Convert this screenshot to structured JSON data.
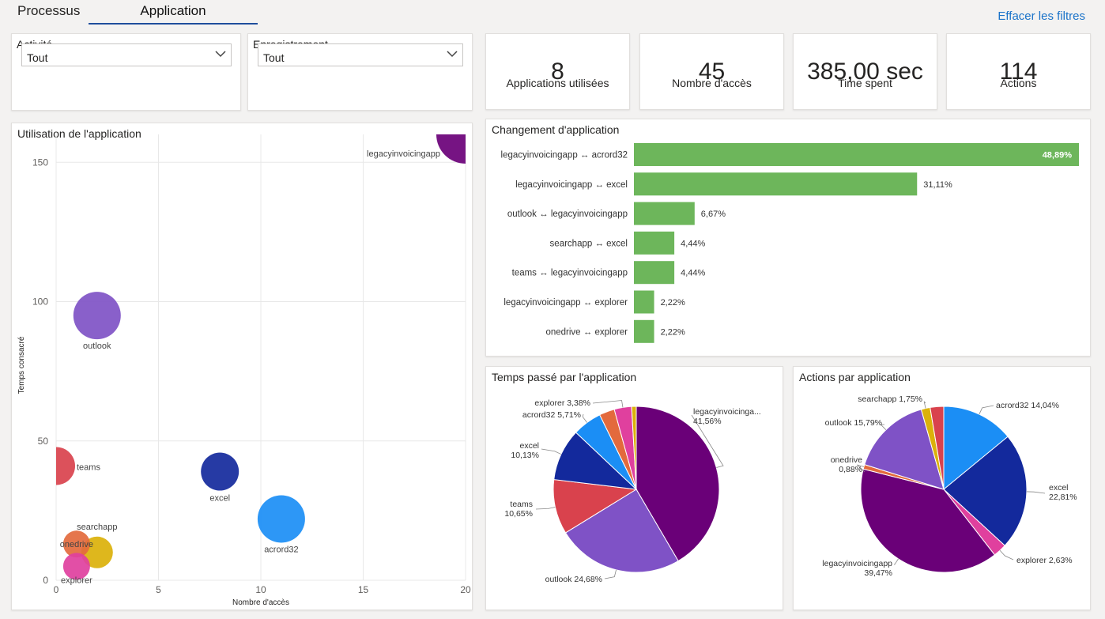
{
  "tabs": [
    {
      "label": "Processus",
      "active": false
    },
    {
      "label": "Application",
      "active": true
    }
  ],
  "clear_filters_label": "Effacer les filtres",
  "filters": [
    {
      "label": "Activité",
      "value": "Tout"
    },
    {
      "label": "Enregistrement",
      "value": "Tout"
    }
  ],
  "kpis": [
    {
      "value": "8",
      "label": "Applications utilisées"
    },
    {
      "value": "45",
      "label": "Nombre d'accès"
    },
    {
      "value": "385,00 sec",
      "label": "Time spent"
    },
    {
      "value": "114",
      "label": "Actions"
    }
  ],
  "colors": {
    "accent": "#1a73c9",
    "bar_green": "#6db65b",
    "legacyinvoicingapp": "#6a0078",
    "outlook": "#7f52c6",
    "teams": "#d9424d",
    "excel": "#13299c",
    "acrord32": "#1b8ef5",
    "searchapp": "#dbb10a",
    "onedrive": "#e36a3d",
    "explorer": "#e0409e"
  },
  "chart_data": [
    {
      "type": "scatter",
      "title": "Utilisation de l'application",
      "xlabel": "Nombre d'accès",
      "ylabel": "Temps consacré",
      "xlim": [
        0,
        20
      ],
      "ylim": [
        0,
        160
      ],
      "xticks": [
        0,
        5,
        10,
        15,
        20
      ],
      "yticks": [
        0,
        50,
        100,
        150
      ],
      "grid": true,
      "points": [
        {
          "name": "legacyinvoicingapp",
          "x": 20,
          "y": 160,
          "size": 37
        },
        {
          "name": "outlook",
          "x": 2,
          "y": 95,
          "size": 30
        },
        {
          "name": "teams",
          "x": 0,
          "y": 41,
          "size": 24
        },
        {
          "name": "excel",
          "x": 8,
          "y": 39,
          "size": 24
        },
        {
          "name": "acrord32",
          "x": 11,
          "y": 22,
          "size": 30
        },
        {
          "name": "searchapp",
          "x": 2,
          "y": 10,
          "size": 20
        },
        {
          "name": "onedrive",
          "x": 1,
          "y": 13,
          "size": 17
        },
        {
          "name": "explorer",
          "x": 1,
          "y": 5,
          "size": 17
        }
      ]
    },
    {
      "type": "bar",
      "title": "Changement d'application",
      "categories": [
        "legacyinvoicingapp ↔ acrord32",
        "legacyinvoicingapp ↔ excel",
        "outlook ↔ legacyinvoicingapp",
        "searchapp ↔ excel",
        "teams ↔ legacyinvoicingapp",
        "legacyinvoicingapp ↔ explorer",
        "onedrive ↔ explorer"
      ],
      "values": [
        48.89,
        31.11,
        6.67,
        4.44,
        4.44,
        2.22,
        2.22
      ],
      "value_labels": [
        "48,89%",
        "31,11%",
        "6,67%",
        "4,44%",
        "4,44%",
        "2,22%",
        "2,22%"
      ]
    },
    {
      "type": "pie",
      "title": "Temps passé par l'application",
      "slices": [
        {
          "name": "legacyinvoicingapp",
          "value": 41.56,
          "label_lines": [
            "legacyinvoicinga...",
            "41,56%"
          ]
        },
        {
          "name": "outlook",
          "value": 24.68,
          "label_lines": [
            "outlook 24,68%"
          ]
        },
        {
          "name": "teams",
          "value": 10.65,
          "label_lines": [
            "teams",
            "10,65%"
          ]
        },
        {
          "name": "excel",
          "value": 10.13,
          "label_lines": [
            "excel",
            "10,13%"
          ]
        },
        {
          "name": "acrord32",
          "value": 5.71,
          "label_lines": [
            "acrord32 5,71%"
          ]
        },
        {
          "name": "onedrive",
          "value": 2.99,
          "label_lines": []
        },
        {
          "name": "explorer",
          "value": 3.38,
          "label_lines": [
            "explorer 3,38%"
          ]
        },
        {
          "name": "searchapp",
          "value": 0.9,
          "label_lines": []
        }
      ]
    },
    {
      "type": "pie",
      "title": "Actions par application",
      "slices": [
        {
          "name": "acrord32",
          "value": 14.04,
          "label_lines": [
            "acrord32 14,04%"
          ]
        },
        {
          "name": "excel",
          "value": 22.81,
          "label_lines": [
            "excel",
            "22,81%"
          ]
        },
        {
          "name": "explorer",
          "value": 2.63,
          "label_lines": [
            "explorer 2,63%"
          ]
        },
        {
          "name": "legacyinvoicingapp",
          "value": 39.47,
          "label_lines": [
            "legacyinvoicingapp",
            "39,47%"
          ]
        },
        {
          "name": "onedrive",
          "value": 0.88,
          "label_lines": [
            "onedrive",
            "0,88%"
          ]
        },
        {
          "name": "outlook",
          "value": 15.79,
          "label_lines": [
            "outlook 15,79%"
          ]
        },
        {
          "name": "searchapp",
          "value": 1.75,
          "label_lines": [
            "searchapp 1,75%"
          ]
        },
        {
          "name": "teams",
          "value": 2.63,
          "label_lines": []
        }
      ]
    }
  ]
}
